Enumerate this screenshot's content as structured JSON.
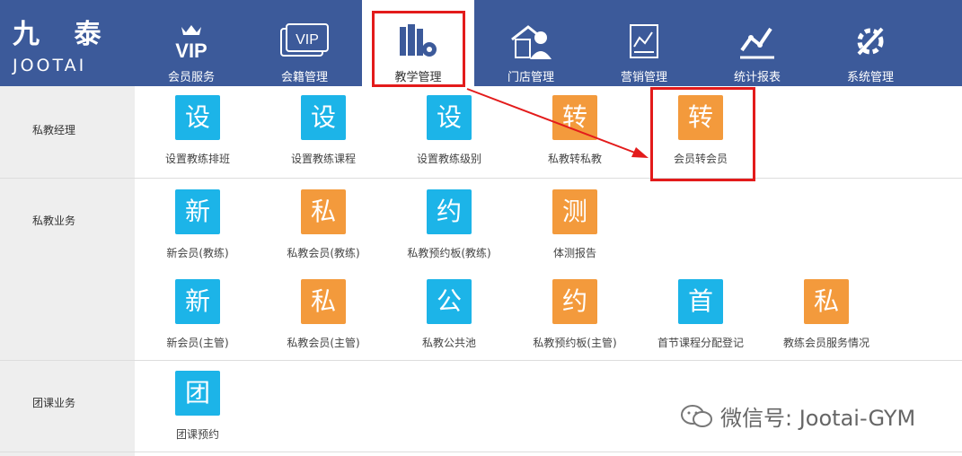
{
  "logo": {
    "cn": "九 泰",
    "en": "JOOTAI"
  },
  "nav": [
    {
      "label": "会员服务",
      "icon": "vip-crown-icon"
    },
    {
      "label": "会籍管理",
      "icon": "vip-card-icon"
    },
    {
      "label": "教学管理",
      "icon": "books-gear-icon"
    },
    {
      "label": "门店管理",
      "icon": "store-manager-icon"
    },
    {
      "label": "营销管理",
      "icon": "marketing-chart-icon"
    },
    {
      "label": "统计报表",
      "icon": "stats-line-icon"
    },
    {
      "label": "系统管理",
      "icon": "settings-tools-icon"
    }
  ],
  "sections": [
    {
      "label": "私教经理",
      "tiles": [
        {
          "glyph": "设",
          "caption": "设置教练排班",
          "color": "blue"
        },
        {
          "glyph": "设",
          "caption": "设置教练课程",
          "color": "blue"
        },
        {
          "glyph": "设",
          "caption": "设置教练级别",
          "color": "blue"
        },
        {
          "glyph": "转",
          "caption": "私教转私教",
          "color": "orange"
        },
        {
          "glyph": "转",
          "caption": "会员转会员",
          "color": "orange"
        }
      ]
    },
    {
      "label": "私教业务",
      "tiles": [
        {
          "glyph": "新",
          "caption": "新会员(教练)",
          "color": "blue"
        },
        {
          "glyph": "私",
          "caption": "私教会员(教练)",
          "color": "orange"
        },
        {
          "glyph": "约",
          "caption": "私教预约板(教练)",
          "color": "blue"
        },
        {
          "glyph": "测",
          "caption": "体测报告",
          "color": "orange"
        },
        {
          "glyph": "新",
          "caption": "新会员(主管)",
          "color": "blue"
        },
        {
          "glyph": "私",
          "caption": "私教会员(主管)",
          "color": "orange"
        },
        {
          "glyph": "公",
          "caption": "私教公共池",
          "color": "blue"
        },
        {
          "glyph": "约",
          "caption": "私教预约板(主管)",
          "color": "orange"
        },
        {
          "glyph": "首",
          "caption": "首节课程分配登记",
          "color": "blue"
        },
        {
          "glyph": "私",
          "caption": "教练会员服务情况",
          "color": "orange"
        }
      ]
    },
    {
      "label": "团课业务",
      "tiles": [
        {
          "glyph": "团",
          "caption": "团课预约",
          "color": "blue"
        }
      ]
    }
  ],
  "watermark": "微信号: Jootai-GYM",
  "colors": {
    "header": "#3c5a9a",
    "tile_blue": "#1cb4e8",
    "tile_orange": "#f39a3c",
    "highlight": "#e31b1b"
  }
}
